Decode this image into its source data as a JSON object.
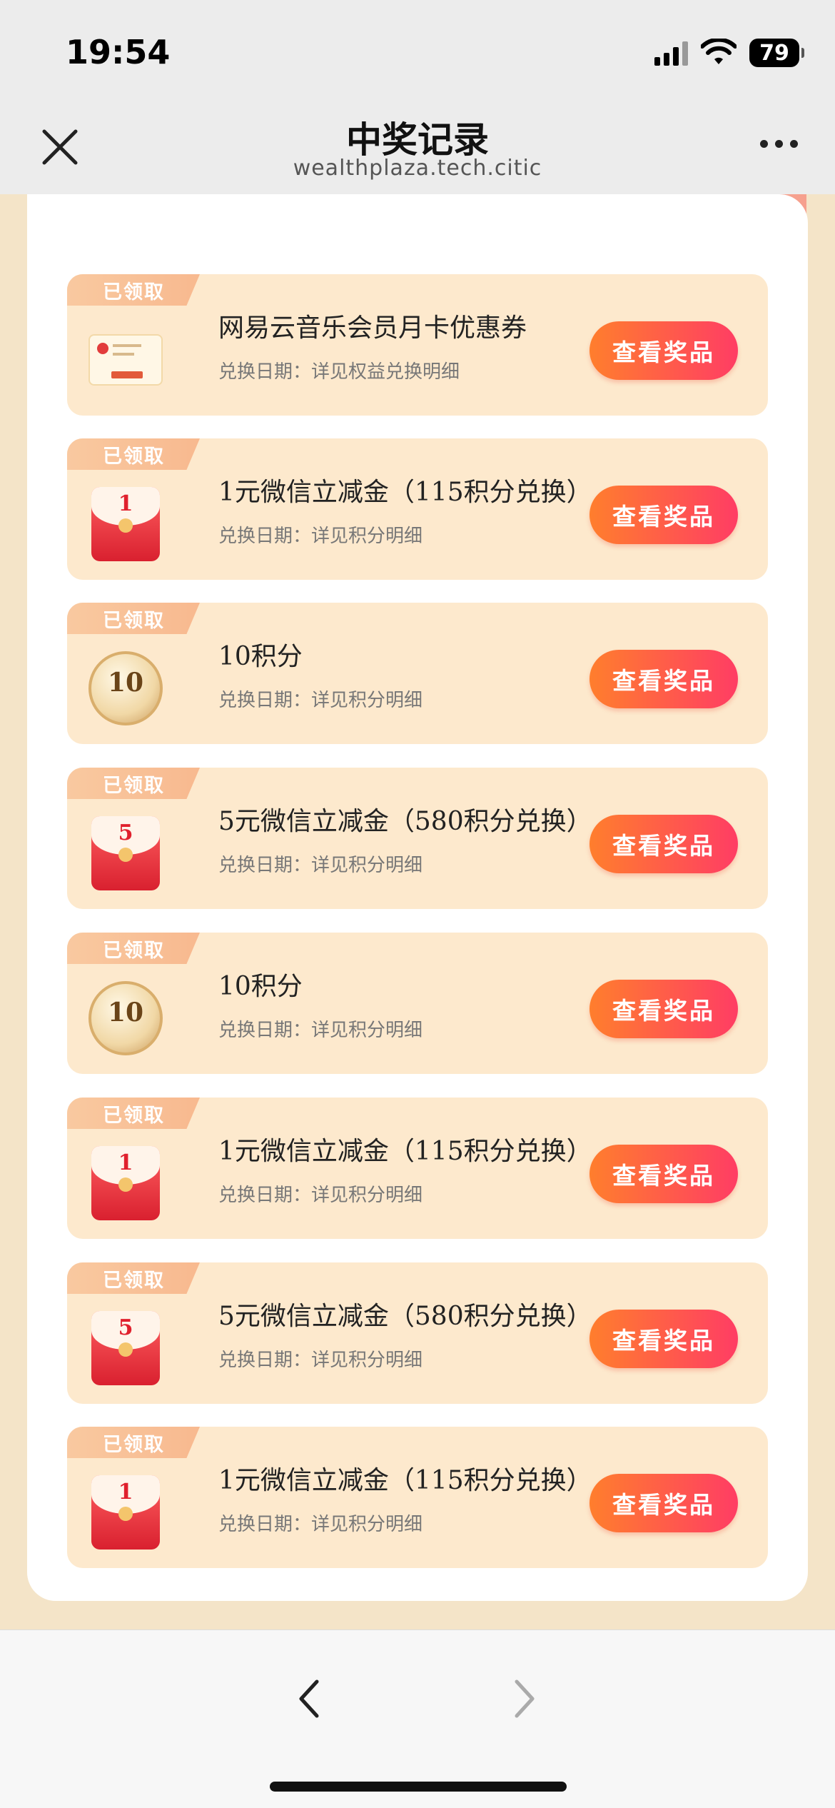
{
  "status_bar": {
    "time": "19:54",
    "battery": "79"
  },
  "header": {
    "title": "中奖记录",
    "domain": "wealthplaza.tech.citic"
  },
  "tag_label": "已领取",
  "button_label": "查看奖品",
  "prizes": [
    {
      "name": "网易云音乐会员月卡优惠券",
      "date": "兑换日期：详见权益兑换明细",
      "icon": "coupon-icon"
    },
    {
      "name": "1元微信立减金（115积分兑换）",
      "date": "兑换日期：详见积分明细",
      "icon": "red-envelope-icon",
      "amount": "1"
    },
    {
      "name": "10积分",
      "date": "兑换日期：详见积分明细",
      "icon": "points-coin-icon",
      "amount": "10"
    },
    {
      "name": "5元微信立减金（580积分兑换）",
      "date": "兑换日期：详见积分明细",
      "icon": "red-envelope-icon",
      "amount": "5"
    },
    {
      "name": "10积分",
      "date": "兑换日期：详见积分明细",
      "icon": "points-coin-icon",
      "amount": "10"
    },
    {
      "name": "1元微信立减金（115积分兑换）",
      "date": "兑换日期：详见积分明细",
      "icon": "red-envelope-icon",
      "amount": "1"
    },
    {
      "name": "5元微信立减金（580积分兑换）",
      "date": "兑换日期：详见积分明细",
      "icon": "red-envelope-icon",
      "amount": "5"
    },
    {
      "name": "1元微信立减金（115积分兑换）",
      "date": "兑换日期：详见积分明细",
      "icon": "red-envelope-icon",
      "amount": "1"
    }
  ],
  "colors": {
    "accent": "#ff5a4a",
    "card_bg": "#fde9cd",
    "page_bg": "#f4e4c8"
  }
}
